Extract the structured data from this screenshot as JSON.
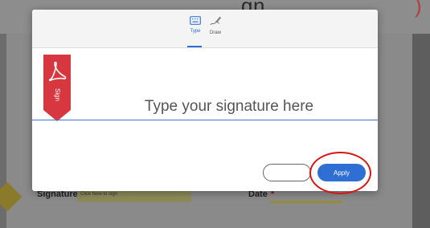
{
  "background": {
    "header_text": "gn",
    "header_marker": ")",
    "signature_label": "Signature",
    "signature_required": "*",
    "signature_placeholder": "Click here to sign",
    "date_label": "Date",
    "date_required": "*"
  },
  "dialog": {
    "tabs": [
      {
        "label": "Type",
        "icon": "keyboard-icon",
        "selected": true
      },
      {
        "label": "Draw",
        "icon": "pen-draw-icon",
        "selected": false
      }
    ],
    "brand": {
      "icon": "adobe-acrobat-icon",
      "ribbon_text": "Sign",
      "color": "#d7373f"
    },
    "signature_input": {
      "placeholder": "Type your signature here",
      "value": ""
    },
    "blank_button_label": "",
    "apply_button_label": "Apply",
    "accent_color": "#2f6fd3",
    "annotation_color": "#d81515"
  }
}
